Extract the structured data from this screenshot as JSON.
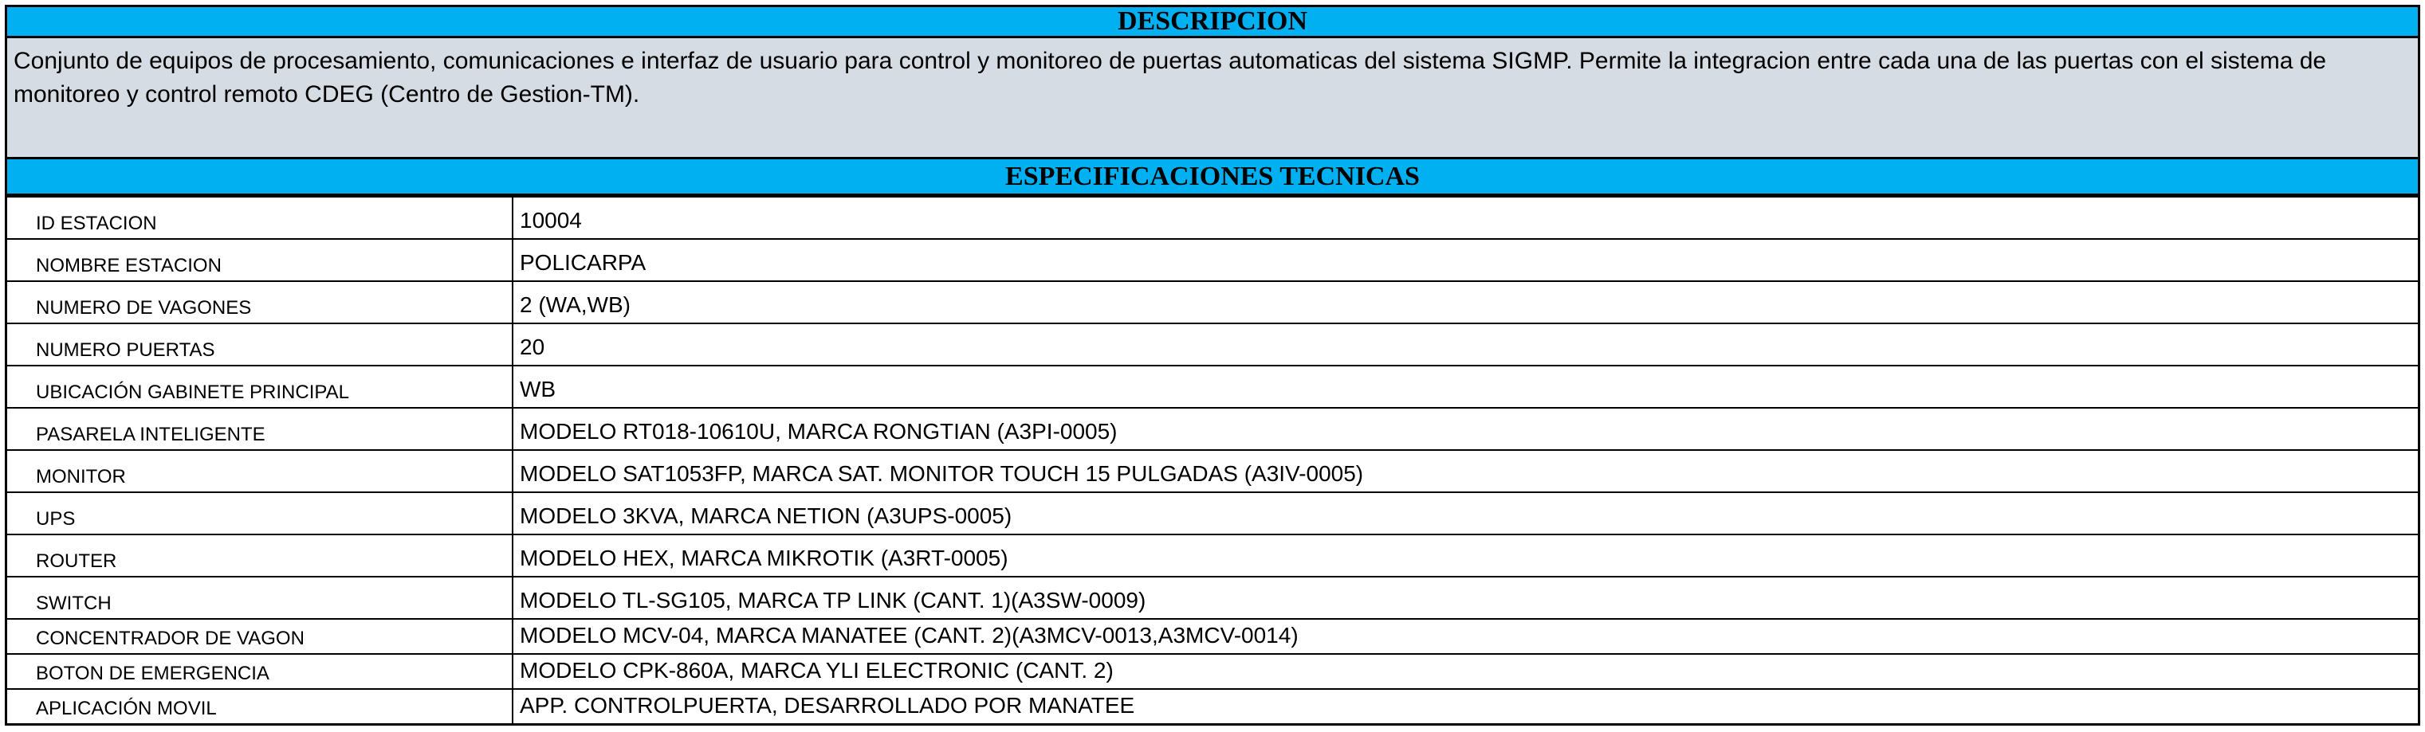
{
  "descripcion": {
    "title": "DESCRIPCION",
    "text": "Conjunto de equipos de procesamiento, comunicaciones e interfaz de usuario para control y monitoreo de puertas automaticas del sistema SIGMP. Permite la integracion entre cada una de las puertas con el sistema de monitoreo y control remoto CDEG (Centro de Gestion-TM)."
  },
  "especificaciones": {
    "title": "ESPECIFICACIONES TECNICAS",
    "rows": [
      {
        "label": "ID ESTACION",
        "value": "10004"
      },
      {
        "label": "NOMBRE ESTACION",
        "value": "POLICARPA"
      },
      {
        "label": "NUMERO DE VAGONES",
        "value": "2 (WA,WB)"
      },
      {
        "label": "NUMERO PUERTAS",
        "value": "20"
      },
      {
        "label": "UBICACIÓN GABINETE PRINCIPAL",
        "value": "WB"
      },
      {
        "label": "PASARELA INTELIGENTE",
        "value": "MODELO RT018-10610U, MARCA RONGTIAN (A3PI-0005)"
      },
      {
        "label": "MONITOR",
        "value": "MODELO SAT1053FP, MARCA SAT. MONITOR TOUCH 15 PULGADAS (A3IV-0005)"
      },
      {
        "label": "UPS",
        "value": "MODELO 3KVA, MARCA NETION (A3UPS-0005)"
      },
      {
        "label": "ROUTER",
        "value": "MODELO HEX, MARCA MIKROTIK (A3RT-0005)"
      },
      {
        "label": "SWITCH",
        "value": "MODELO TL-SG105, MARCA TP LINK (CANT. 1)(A3SW-0009)"
      },
      {
        "label": "CONCENTRADOR DE VAGON",
        "value": "MODELO MCV-04, MARCA MANATEE (CANT. 2)(A3MCV-0013,A3MCV-0014)"
      },
      {
        "label": "BOTON DE EMERGENCIA",
        "value": "MODELO CPK-860A, MARCA YLI ELECTRONIC (CANT. 2)"
      },
      {
        "label": "APLICACIÓN MOVIL",
        "value": "APP. CONTROLPUERTA, DESARROLLADO POR MANATEE"
      }
    ]
  },
  "colors": {
    "header_band": "#00b0f0",
    "description_bg": "#d6dce4",
    "border": "#000000"
  }
}
